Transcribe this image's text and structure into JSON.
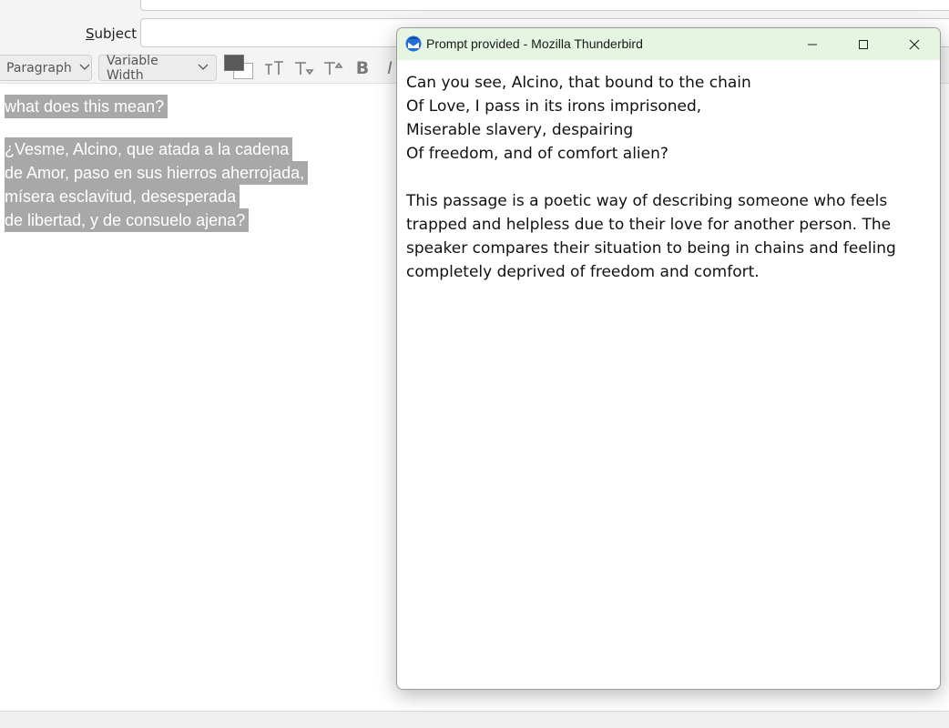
{
  "compose": {
    "subject_label_prefix": "S",
    "subject_label_rest": "ubject",
    "subject_value": "",
    "toolbar": {
      "paragraph_format": "Paragraph",
      "font_family": "Variable Width",
      "text_color": "#595959",
      "background_color": "#ffffff"
    },
    "body_lines": [
      "what does this mean?",
      "¿Vesme, Alcino, que atada a la cadena",
      "de Amor, paso en sus hierros aherrojada,",
      "mísera esclavitud, desesperada",
      "de libertad, y de consuelo ajena?"
    ]
  },
  "dialog": {
    "title": "Prompt provided - Mozilla Thunderbird",
    "titlebar_color": "#e6f4e2",
    "verse_lines": [
      "Can you see, Alcino, that bound to the chain",
      "Of Love, I pass in its irons imprisoned,",
      "Miserable slavery, despairing",
      "Of freedom, and of comfort alien?"
    ],
    "explanation_lines": [
      "This passage is a poetic way of describing someone who feels",
      "trapped and helpless due to their love for another person. The",
      "speaker compares their situation to being in chains and feeling",
      "completely deprived of freedom and comfort."
    ]
  }
}
